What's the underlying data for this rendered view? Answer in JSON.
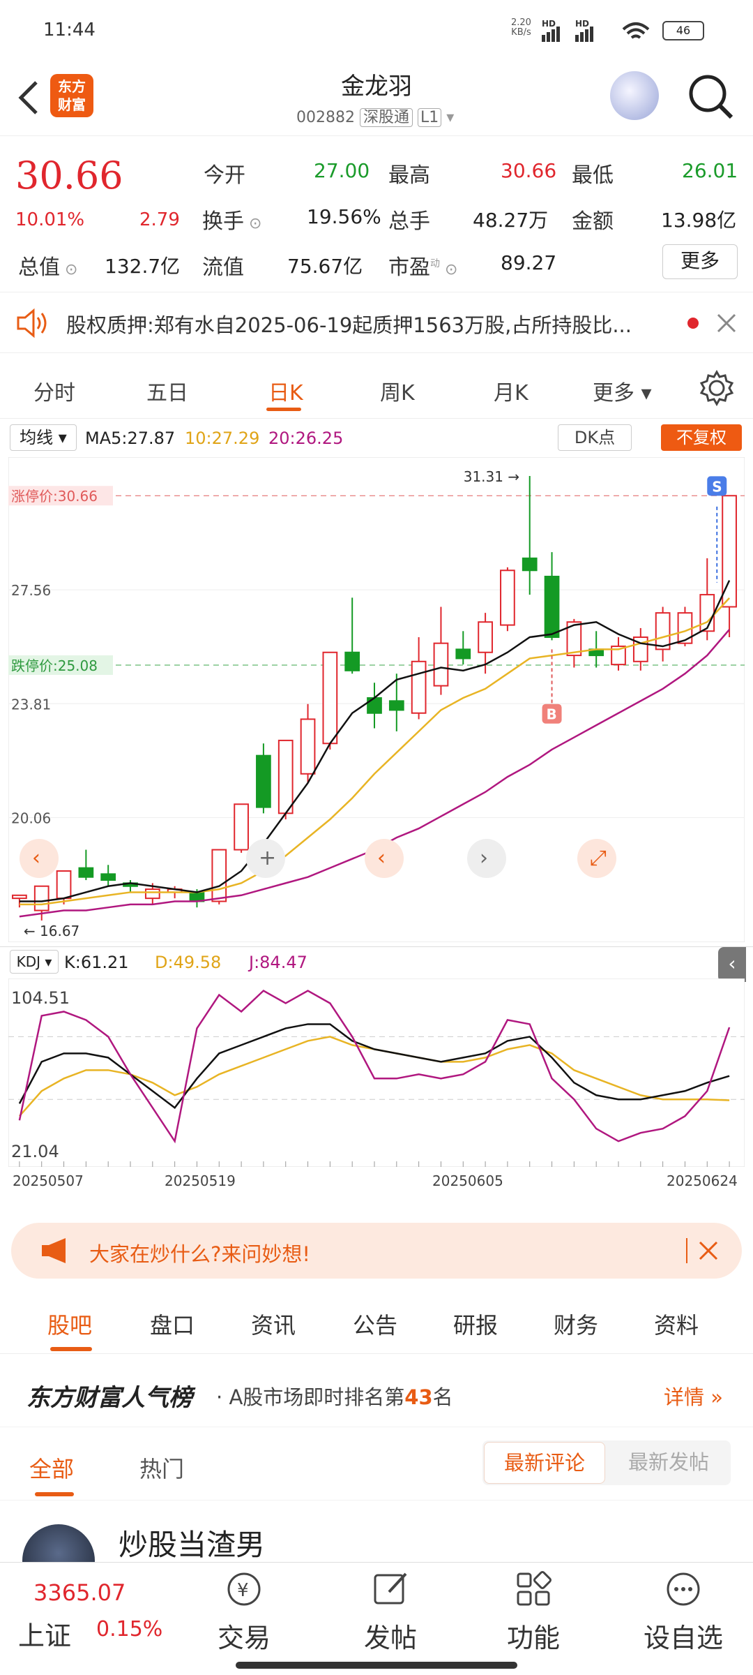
{
  "status": {
    "time": "11:44",
    "net_speed_top": "2.20",
    "net_speed_unit": "KB/s",
    "battery": "46"
  },
  "header": {
    "stock_name": "金龙羽",
    "code": "002882",
    "market_tag": "深股通",
    "level_tag": "L1",
    "logo_line1": "东方",
    "logo_line2": "财富"
  },
  "quote": {
    "price": "30.66",
    "change_pct": "10.01%",
    "change": "2.79",
    "open_label": "今开",
    "open": "27.00",
    "high_label": "最高",
    "high": "30.66",
    "low_label": "最低",
    "low": "26.01",
    "turnover_label": "换手",
    "turnover": "19.56%",
    "volume_label": "总手",
    "volume": "48.27万",
    "amount_label": "金额",
    "amount": "13.98亿",
    "mcap_label": "总值",
    "mcap": "132.7亿",
    "float_label": "流值",
    "float": "75.67亿",
    "pe_label": "市盈",
    "pe_sup": "动",
    "pe": "89.27",
    "more": "更多"
  },
  "notice": {
    "text": "股权质押:郑有水自2025-06-19起质押1563万股,占所持股比..."
  },
  "chart_tabs": [
    "分时",
    "五日",
    "日K",
    "周K",
    "月K",
    "更多"
  ],
  "chart_tab_active": 2,
  "ma_bar": {
    "selector": "均线",
    "ma5": "MA5:27.87",
    "ma10": "10:27.29",
    "ma20": "20:26.25",
    "dk": "DK点",
    "fuquan": "不复权"
  },
  "kdj_bar": {
    "selector": "KDJ",
    "k": "K:61.21",
    "d": "D:49.58",
    "j": "J:84.47"
  },
  "chart_data": {
    "type": "candlestick",
    "price_labels": {
      "limit_up": "涨停价:30.66",
      "limit_down": "跌停价:25.08",
      "top": "31.31",
      "p1": "27.56",
      "p2": "23.81",
      "p3": "20.06",
      "low": "16.67"
    },
    "y_range": [
      16.3,
      31.7
    ],
    "candles": [
      [
        17.4,
        17.5,
        17.1,
        17.5
      ],
      [
        17.0,
        17.8,
        16.67,
        17.4
      ],
      [
        17.4,
        18.3,
        17.2,
        18.1
      ],
      [
        18.4,
        18.1,
        18.0,
        19.0
      ],
      [
        18.2,
        18.0,
        17.8,
        18.5
      ],
      [
        17.9,
        17.8,
        17.6,
        18.0
      ],
      [
        17.4,
        17.7,
        17.2,
        17.9
      ],
      [
        17.6,
        17.7,
        17.4,
        17.8
      ],
      [
        17.6,
        17.3,
        17.1,
        17.7
      ],
      [
        17.3,
        19.0,
        17.2,
        19.0
      ],
      [
        19.0,
        20.5,
        18.9,
        20.5
      ],
      [
        22.1,
        20.4,
        20.2,
        22.5
      ],
      [
        20.2,
        22.6,
        20.0,
        22.6
      ],
      [
        21.5,
        23.3,
        21.2,
        23.8
      ],
      [
        22.5,
        25.5,
        22.3,
        25.5
      ],
      [
        25.5,
        24.9,
        24.8,
        27.3
      ],
      [
        24.0,
        23.5,
        23.0,
        24.5
      ],
      [
        23.9,
        23.6,
        22.9,
        24.8
      ],
      [
        23.5,
        25.2,
        23.3,
        26.0
      ],
      [
        24.4,
        25.8,
        24.1,
        27.0
      ],
      [
        25.6,
        25.3,
        25.1,
        26.2
      ],
      [
        25.5,
        26.5,
        24.8,
        26.8
      ],
      [
        26.4,
        28.2,
        26.2,
        28.3
      ],
      [
        28.6,
        28.2,
        27.4,
        31.31
      ],
      [
        28.0,
        26.0,
        25.9,
        28.8
      ],
      [
        25.4,
        26.5,
        25.0,
        26.6
      ],
      [
        25.6,
        25.4,
        25.0,
        26.2
      ],
      [
        25.1,
        25.7,
        24.9,
        26.0
      ],
      [
        25.2,
        26.0,
        24.9,
        26.3
      ],
      [
        25.6,
        26.8,
        25.2,
        27.0
      ],
      [
        25.8,
        26.8,
        25.7,
        27.0
      ],
      [
        26.2,
        27.4,
        25.9,
        28.6
      ],
      [
        27.0,
        30.66,
        26.0,
        30.66
      ]
    ],
    "ma5": [
      17.3,
      17.3,
      17.4,
      17.6,
      17.8,
      17.9,
      17.8,
      17.7,
      17.6,
      17.8,
      18.3,
      19.2,
      20.2,
      21.2,
      22.5,
      23.5,
      24.0,
      24.6,
      24.8,
      25.0,
      24.9,
      25.1,
      25.5,
      26.0,
      26.1,
      26.4,
      26.5,
      26.1,
      25.8,
      25.7,
      25.9,
      26.3,
      27.87
    ],
    "ma10": [
      17.2,
      17.2,
      17.3,
      17.4,
      17.5,
      17.6,
      17.6,
      17.6,
      17.6,
      17.7,
      17.9,
      18.3,
      18.8,
      19.4,
      20.0,
      20.7,
      21.5,
      22.2,
      22.9,
      23.6,
      24.0,
      24.3,
      24.8,
      25.3,
      25.4,
      25.5,
      25.6,
      25.6,
      25.8,
      26.0,
      26.2,
      26.5,
      27.29
    ],
    "ma20": [
      16.8,
      16.9,
      17.0,
      17.0,
      17.1,
      17.2,
      17.2,
      17.3,
      17.3,
      17.4,
      17.5,
      17.7,
      17.9,
      18.1,
      18.4,
      18.7,
      19.0,
      19.4,
      19.7,
      20.1,
      20.5,
      20.9,
      21.4,
      21.8,
      22.3,
      22.7,
      23.1,
      23.5,
      23.9,
      24.3,
      24.8,
      25.4,
      26.25
    ],
    "kdj_labels": {
      "top": "104.51",
      "bottom": "21.04"
    },
    "k": [
      48,
      68,
      72,
      72,
      70,
      62,
      54,
      46,
      60,
      72,
      76,
      80,
      84,
      86,
      86,
      78,
      74,
      72,
      70,
      68,
      70,
      72,
      78,
      80,
      70,
      58,
      52,
      50,
      50,
      52,
      54,
      58,
      61.21
    ],
    "d": [
      42,
      54,
      60,
      64,
      64,
      62,
      58,
      52,
      56,
      62,
      66,
      70,
      74,
      78,
      80,
      76,
      74,
      72,
      70,
      68,
      68,
      70,
      74,
      76,
      72,
      64,
      60,
      56,
      52,
      50,
      50,
      50,
      49.58
    ],
    "j": [
      40,
      90,
      92,
      88,
      80,
      62,
      46,
      30,
      84,
      100,
      92,
      102,
      96,
      102,
      96,
      80,
      60,
      60,
      62,
      60,
      62,
      68,
      88,
      86,
      60,
      50,
      36,
      30,
      34,
      36,
      42,
      54,
      84.47
    ],
    "x_dates": [
      "20250507",
      "20250519",
      "20250605",
      "20250624"
    ],
    "markers": {
      "buy": "B",
      "sell": "S"
    }
  },
  "ad": {
    "text": "大家在炒什么?来问妙想!"
  },
  "bottom_tabs": [
    "股吧",
    "盘口",
    "资讯",
    "公告",
    "研报",
    "财务",
    "资料"
  ],
  "rank": {
    "brand": "东方财富人气榜",
    "text_prefix": "A股市场即时排名第",
    "rank_num": "43",
    "text_suffix": "名",
    "detail": "详情"
  },
  "filter_tabs": {
    "all": "全部",
    "hot": "热门",
    "latest_comment": "最新评论",
    "latest_post": "最新发帖"
  },
  "post": {
    "author": "炒股当渣男"
  },
  "nav": {
    "index_value": "3365.07",
    "index_name": "上证",
    "index_pct": "0.15%",
    "trade": "交易",
    "post": "发帖",
    "func": "功能",
    "watch": "设自选"
  }
}
